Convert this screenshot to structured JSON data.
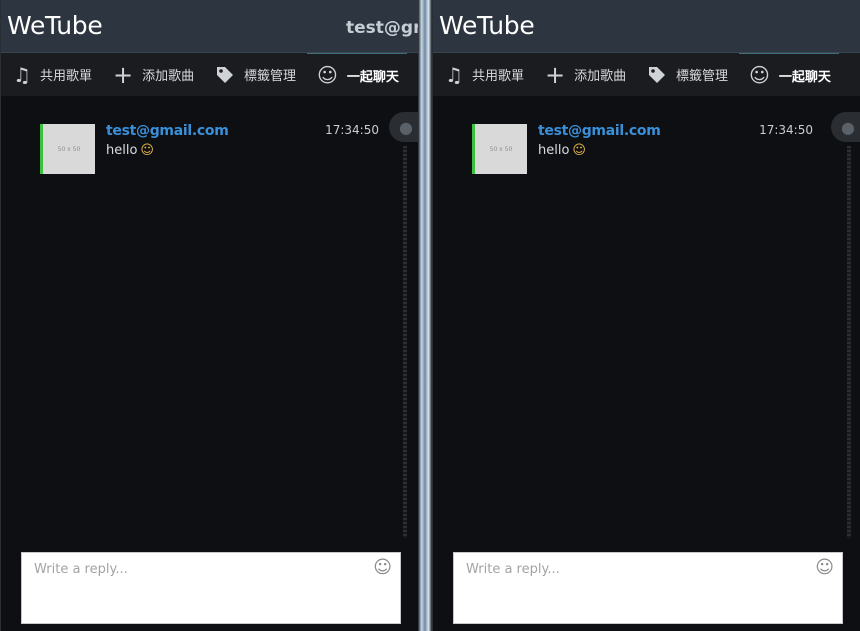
{
  "app": {
    "title": "WeTube",
    "user_email": "test@gm"
  },
  "nav": {
    "items": [
      {
        "label": "共用歌單",
        "icon": "music-note-icon"
      },
      {
        "label": "添加歌曲",
        "icon": "plus-icon"
      },
      {
        "label": "標籤管理",
        "icon": "tag-icon"
      },
      {
        "label": "一起聊天",
        "icon": "smiley-icon",
        "active": true
      }
    ]
  },
  "chat": {
    "messages": [
      {
        "author": "test@gmail.com",
        "time": "17:34:50",
        "text": "hello",
        "avatar_placeholder": "50 x 50"
      }
    ],
    "reply_placeholder": "Write a reply..."
  },
  "colors": {
    "author": "#3a8fd9",
    "avatar_accent": "#3fbf3f",
    "topbar": "#2d3640"
  }
}
